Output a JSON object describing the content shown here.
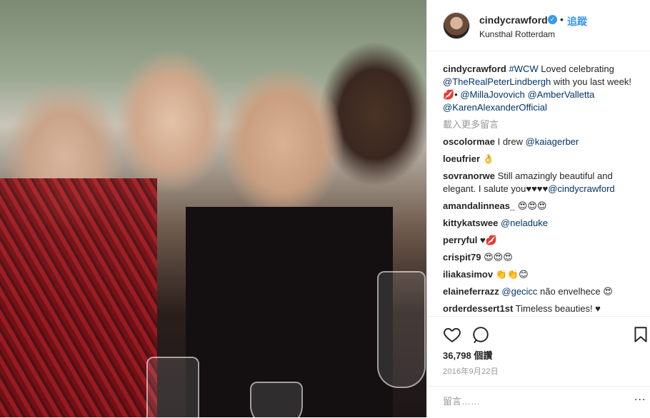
{
  "post": {
    "username": "cindycrawford",
    "follow_label": "追蹤",
    "dot": "•",
    "location": "Kunsthal Rotterdam",
    "verified_icon": "verified-badge-icon"
  },
  "caption": {
    "user": "cindycrawford",
    "hashtag": "#WCW",
    "text1": " Loved celebrating ",
    "mention1": "@TheRealPeterLindbergh",
    "text2": " with you last week! 💋• ",
    "mention2": "@MillaJovovich",
    "text3": " ",
    "mention3": "@AmberValletta",
    "text4": " ",
    "mention4": "@KarenAlexanderOfficial"
  },
  "load_more": "載入更多留言",
  "comments": [
    {
      "user": "oscolormae",
      "text": " I drew ",
      "mention": "@kaiagerber",
      "after": ""
    },
    {
      "user": "loeufrier",
      "text": " 👌",
      "mention": "",
      "after": ""
    },
    {
      "user": "sovranorwe",
      "text": " Still amazingly beautiful and elegant. I salute you♥♥♥♥",
      "mention": "@cindycrawford",
      "after": ""
    },
    {
      "user": "amandalinneas_",
      "text": " 😍😍😍",
      "mention": "",
      "after": ""
    },
    {
      "user": "kittykatswee",
      "text": " ",
      "mention": "@neladuke",
      "after": ""
    },
    {
      "user": "perryful",
      "text": " ♥💋",
      "mention": "",
      "after": ""
    },
    {
      "user": "crispit79",
      "text": " 😍😍😍",
      "mention": "",
      "after": ""
    },
    {
      "user": "iliakasimov",
      "text": " 👏👏😊",
      "mention": "",
      "after": ""
    },
    {
      "user": "elaineferrazz",
      "text": " ",
      "mention": "@gecicc",
      "after": " não envelhece 😍"
    },
    {
      "user": "orderdessert1st",
      "text": " Timeless beauties! ♥",
      "mention": "",
      "after": ""
    }
  ],
  "likes": "36,798 個讚",
  "date": "2016年9月22日",
  "comment_placeholder": "留言……",
  "more_options": "...",
  "colors": {
    "accent": "#3897f0",
    "link": "#003569",
    "muted": "#999999"
  }
}
